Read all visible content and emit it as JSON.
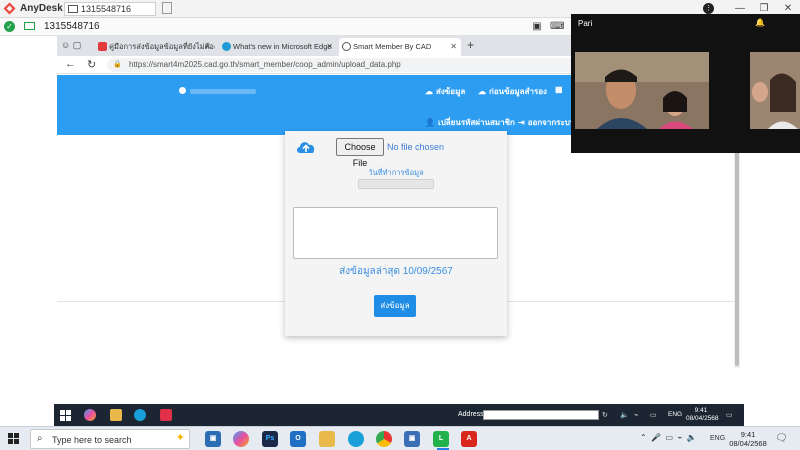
{
  "anydesk": {
    "app_name": "AnyDesk",
    "tab_label": "1315548716",
    "connection_id": "1315548716"
  },
  "browser": {
    "tabs": [
      {
        "label": "คู่มือการส่งข้อมูลข้อมูลที่ยังไม่ต้องส่ง"
      },
      {
        "label": "What's new in Microsoft Edge"
      },
      {
        "label": "Smart Member By CAD"
      }
    ],
    "url": "https://smart4m2025.cad.go.th/smart_member/coop_admin/upload_data.php"
  },
  "site": {
    "nav": [
      {
        "label": "ส่งข้อมูล",
        "icon": "cloud-upload-icon"
      },
      {
        "label": "ก่อนข้อมูลสำรอง",
        "icon": "cloud-download-icon"
      },
      {
        "label": "เปลี่ยนรหัสผ่านสมาชิก",
        "icon": "user-key-icon"
      },
      {
        "label": "ออกจากระบบ",
        "icon": "sign-out-icon"
      }
    ]
  },
  "upload": {
    "choose_file": "Choose File",
    "no_file": "No file chosen",
    "date_label": "วันที่ทำการข้อมูล",
    "last_sent": "ส่งข้อมูลล่าสุด 10/09/2567",
    "submit": "ส่งข้อมูล"
  },
  "video": {
    "participant_name": "Pari"
  },
  "remote_taskbar": {
    "address_label": "Address",
    "lang": "ENG",
    "time": "9:41",
    "date": "08/04/2568"
  },
  "local_taskbar": {
    "search_placeholder": "Type here to search",
    "lang": "ENG",
    "time": "9:41",
    "date": "08/04/2568"
  }
}
